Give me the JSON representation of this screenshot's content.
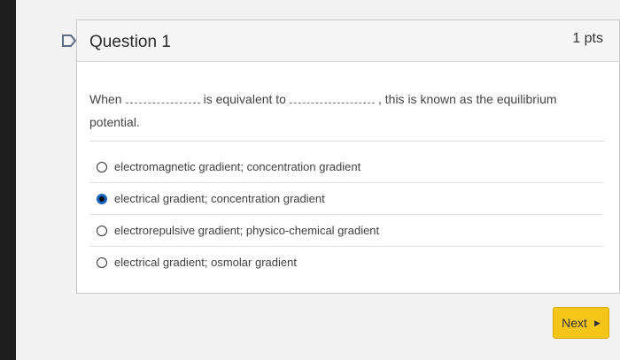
{
  "question": {
    "title": "Question 1",
    "points": "1 pts",
    "prompt": {
      "part1": "When",
      "part2": "is equivalent to",
      "part3": ", this is known as the equilibrium",
      "part4": "potential."
    }
  },
  "answers": [
    {
      "label": "electromagnetic gradient; concentration gradient",
      "selected": false
    },
    {
      "label": "electrical gradient; concentration gradient",
      "selected": true
    },
    {
      "label": "electrorepulsive gradient; physico-chemical gradient",
      "selected": false
    },
    {
      "label": "electrical gradient; osmolar gradient",
      "selected": false
    }
  ],
  "nav": {
    "next_label": "Next"
  },
  "colors": {
    "next_button": "#f5c518",
    "selected_radio": "#1565c0"
  }
}
